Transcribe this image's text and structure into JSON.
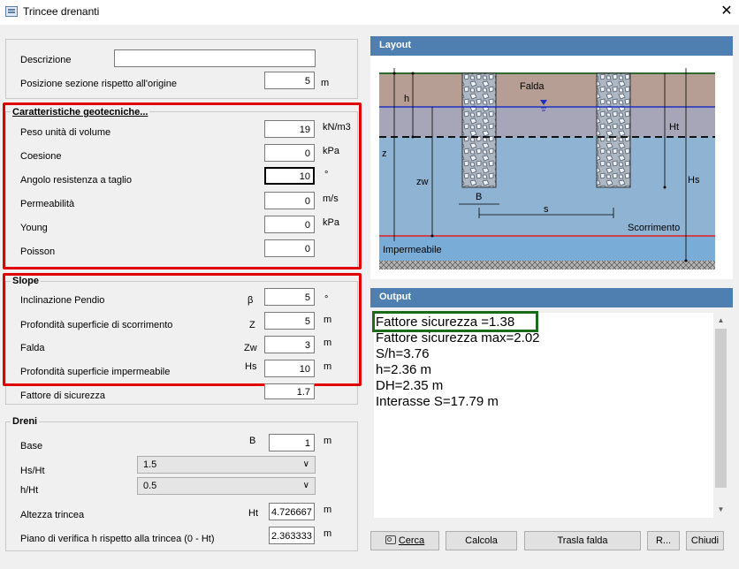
{
  "window": {
    "title": "Trincee drenanti",
    "close_glyph": "✕"
  },
  "general": {
    "descrizione_label": "Descrizione",
    "descrizione_value": "",
    "posizione_label": "Posizione sezione rispetto all'origine",
    "posizione_value": "5",
    "posizione_unit": "m"
  },
  "geotech": {
    "legend": "Caratteristiche geotecniche...",
    "rows": [
      {
        "label": "Peso unità di volume",
        "value": "19",
        "unit": "kN/m3"
      },
      {
        "label": "Coesione",
        "value": "0",
        "unit": "kPa"
      },
      {
        "label": "Angolo  resistenza a taglio",
        "value": "10",
        "unit": "°"
      },
      {
        "label": "Permeabilità",
        "value": "0",
        "unit": "m/s"
      },
      {
        "label": "Young",
        "value": "0",
        "unit": "kPa"
      },
      {
        "label": "Poisson",
        "value": "0",
        "unit": ""
      }
    ]
  },
  "slope": {
    "legend": "Slope",
    "rows": [
      {
        "label": "Inclinazione Pendio",
        "symbol": "β",
        "value": "5",
        "unit": "°"
      },
      {
        "label": "Profondità superficie di scorrimento",
        "symbol": "Z",
        "value": "5",
        "unit": "m"
      },
      {
        "label": "Falda",
        "symbol": "Zw",
        "value": "3",
        "unit": "m"
      },
      {
        "label": "Profondità superficie impermeabile",
        "symbol": "Hs",
        "value": "10",
        "unit": "m"
      }
    ],
    "fattore_label": "Fattore di sicurezza",
    "fattore_value": "1.7"
  },
  "dreni": {
    "legend": "Dreni",
    "base_label": "Base",
    "base_symbol": "B",
    "base_value": "1",
    "base_unit": "m",
    "hsht_label": "Hs/Ht",
    "hsht_value": "1.5",
    "hht_label": "h/Ht",
    "hht_value": "0.5",
    "altezza_label": "Altezza trincea",
    "altezza_symbol": "Ht",
    "altezza_value": "4.726667",
    "altezza_unit": "m",
    "piano_label": "Piano di verifica h rispetto alla trincea (0 - Ht)",
    "piano_value": "2.363333",
    "piano_unit": "m"
  },
  "layout_panel": {
    "header": "Layout",
    "labels": {
      "h": "h",
      "falda": "Falda",
      "ht": "Ht",
      "z": "z",
      "zw": "zw",
      "hs": "Hs",
      "b": "B",
      "s": "s",
      "scorrimento": "Scorrimento",
      "impermeabile": "Impermeabile"
    },
    "colors": {
      "soil_top": "#b69e94",
      "soil_water": "#8eb3d3",
      "bottom": "#7aacd8",
      "water_line": "#2030c0",
      "slip_line": "#e02020",
      "gravel": "#9aa7b5"
    }
  },
  "output_panel": {
    "header": "Output",
    "lines": [
      "Fattore sicurezza =1.38",
      "Fattore sicurezza max=2.02",
      "S/h=3.76",
      "h=2.36 m",
      "DH=2.35 m",
      "Interasse S=17.79 m"
    ]
  },
  "buttons": {
    "cerca": "Cerca",
    "calcola": "Calcola",
    "trasla": "Trasla falda",
    "r": "R...",
    "chiudi": "Chiudi"
  },
  "highlight_colors": {
    "red": "#e00000",
    "green": "#1a6b1a",
    "header_blue": "#4f7fb0"
  }
}
